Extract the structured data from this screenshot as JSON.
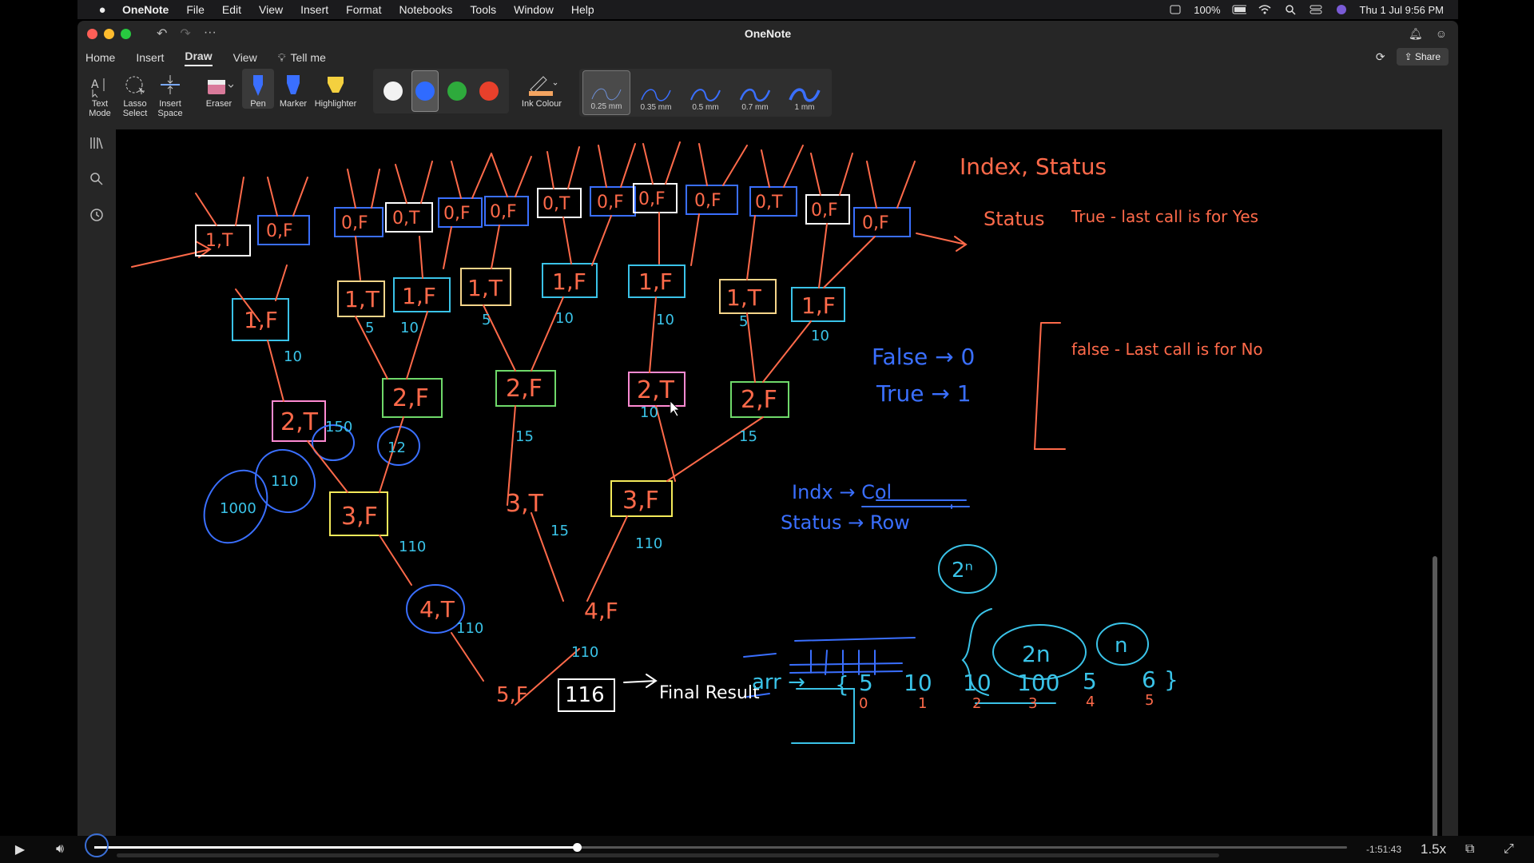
{
  "menubar": {
    "app": "OneNote",
    "items": [
      "File",
      "Edit",
      "View",
      "Insert",
      "Format",
      "Notebooks",
      "Tools",
      "Window",
      "Help"
    ],
    "battery": "100%",
    "clock": "Thu 1 Jul  9:56 PM"
  },
  "window": {
    "title": "OneNote"
  },
  "tabs": {
    "items": [
      "Home",
      "Insert",
      "Draw",
      "View"
    ],
    "active": "Draw",
    "tell_me": "Tell me",
    "share": "Share"
  },
  "ribbon": {
    "text_mode": "Text Mode",
    "lasso": "Lasso Select",
    "insert_space": "Insert Space",
    "eraser": "Eraser",
    "pen": "Pen",
    "marker": "Marker",
    "highlighter": "Highlighter",
    "ink_colour": "Ink Colour",
    "swatches": [
      "#f2f2f2",
      "#2f6bff",
      "#2eaa3c",
      "#e8402b"
    ],
    "selected_swatch": "#2f6bff",
    "thickness": [
      "0.25 mm",
      "0.35 mm",
      "0.5 mm",
      "0.7 mm",
      "1 mm"
    ],
    "selected_thickness": "0.25 mm"
  },
  "canvas": {
    "nodes_row1": [
      "1,T",
      "0,F",
      "0,F",
      "0,T",
      "0,F",
      "0,F",
      "0,T",
      "0,F",
      "0,F",
      "0,F",
      "0,T",
      "0,F",
      "0,F"
    ],
    "nodes_row2": [
      "1,F",
      "1,T",
      "1,F",
      "1,T",
      "1,F",
      "1,F",
      "1,T",
      "1,F"
    ],
    "nodes_row3": [
      "2,T",
      "2,F",
      "2,F",
      "2,T",
      "2,F"
    ],
    "nodes_row4": [
      "3,F",
      "3,T",
      "3,F"
    ],
    "nodes_row5": [
      "4,T",
      "4,F"
    ],
    "root": "5,F",
    "final": "116",
    "final_label": "Final Result",
    "index_status": "Index, Status",
    "status_label": "Status",
    "true_branch": "True - last call is for Yes",
    "false_branch": "false - Last call is for No",
    "mapping1": "False → 0",
    "mapping2": "True → 1",
    "indx_col": "Indx → Col",
    "status_row": "Status → Row",
    "dp_label": "2n",
    "n_label": "n",
    "pow_label": "2ⁿ",
    "arr_label": "arr →",
    "arr_values": [
      "5",
      "10",
      "10",
      "100",
      "5",
      "6"
    ],
    "arr_indices": [
      "0",
      "1",
      "2",
      "3",
      "4",
      "5"
    ],
    "leaf_values": [
      "5",
      "10",
      "15",
      "110",
      "116",
      "150",
      "100",
      "1000",
      "12",
      "110"
    ]
  },
  "player": {
    "time_left": "-1:51:43",
    "speed": "1.5x",
    "progress": 0.385
  }
}
